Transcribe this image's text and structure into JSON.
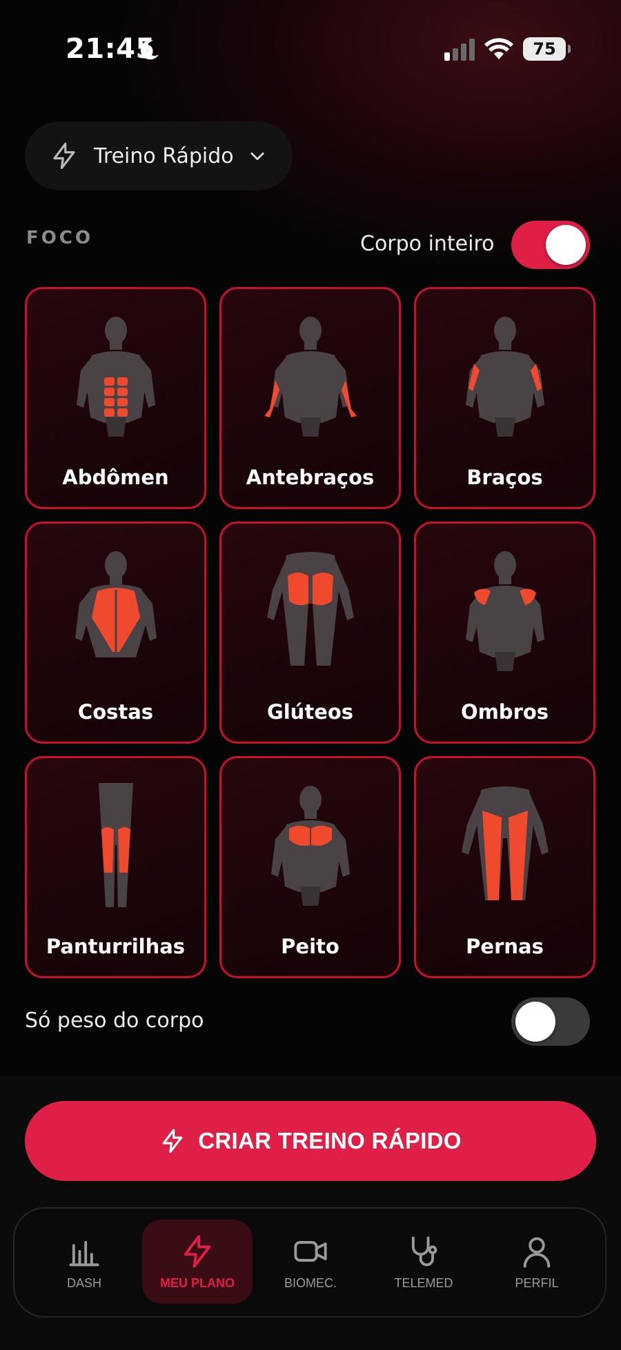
{
  "status_bar": {
    "time": "21:45",
    "battery": "75",
    "icons": [
      "moon-icon",
      "cellular-signal-icon",
      "wifi-icon",
      "battery-icon"
    ]
  },
  "mode_selector": {
    "label": "Treino Rápido",
    "icon": "lightning-bolt-icon"
  },
  "focus": {
    "section_label": "FOCO",
    "whole_body_label": "Corpo inteiro",
    "whole_body_enabled": true,
    "muscles": [
      {
        "label": "Abdômen",
        "icon": "abdomen-figure-icon"
      },
      {
        "label": "Antebraços",
        "icon": "forearms-figure-icon"
      },
      {
        "label": "Braços",
        "icon": "arms-figure-icon"
      },
      {
        "label": "Costas",
        "icon": "back-figure-icon"
      },
      {
        "label": "Glúteos",
        "icon": "glutes-figure-icon"
      },
      {
        "label": "Ombros",
        "icon": "shoulders-figure-icon"
      },
      {
        "label": "Panturrilhas",
        "icon": "calves-figure-icon"
      },
      {
        "label": "Peito",
        "icon": "chest-figure-icon"
      },
      {
        "label": "Pernas",
        "icon": "legs-figure-icon"
      }
    ]
  },
  "bodyweight": {
    "label": "Só peso do corpo",
    "enabled": false
  },
  "cta": {
    "label": "CRIAR TREINO RÁPIDO"
  },
  "nav": {
    "active": "MEU PLANO",
    "items": [
      {
        "label": "DASH",
        "icon": "bar-chart-icon"
      },
      {
        "label": "MEU PLANO",
        "icon": "lightning-bolt-icon"
      },
      {
        "label": "BIOMEC.",
        "icon": "video-camera-icon"
      },
      {
        "label": "TELEMED",
        "icon": "stethoscope-icon"
      },
      {
        "label": "PERFIL",
        "icon": "user-icon"
      }
    ]
  },
  "colors": {
    "accent": "#e01f47",
    "card_border": "#c8102e",
    "muscle_highlight": "#f04a2e",
    "figure_gray": "#4a4346"
  }
}
